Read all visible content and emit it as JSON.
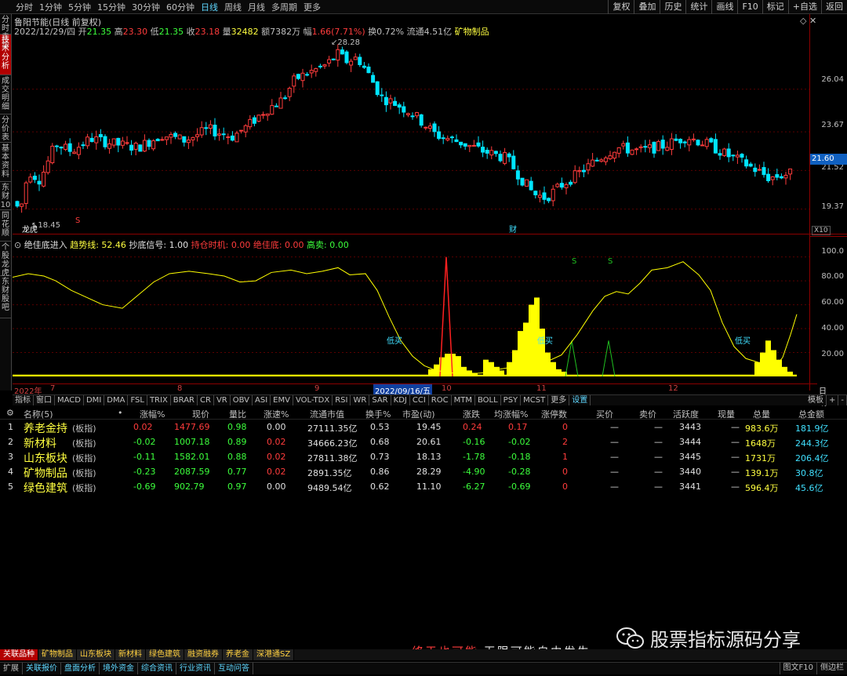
{
  "topbar": {
    "periods": [
      "分时",
      "1分钟",
      "5分钟",
      "15分钟",
      "30分钟",
      "60分钟",
      "日线",
      "周线",
      "月线",
      "多周期",
      "更多"
    ],
    "active_period": "日线",
    "right_buttons": [
      "复权",
      "叠加",
      "历史",
      "统计",
      "画线",
      "F10",
      "标记",
      "+自选",
      "返回"
    ]
  },
  "leftnav": [
    "分时走势",
    "技术分析",
    "成交明细",
    "分价表",
    "基本资料",
    "东财10",
    "同花顺",
    "个股龙虎",
    "东财股吧"
  ],
  "stock": {
    "title": "鲁阳节能(日线 前复权)",
    "date": "2022/12/29/四",
    "open_label": "开",
    "open": "21.35",
    "high_label": "高",
    "high": "23.30",
    "low_label": "低",
    "low": "21.35",
    "close_label": "收",
    "close": "23.18",
    "vol_label": "量",
    "vol": "32482",
    "amt_label": "额",
    "amt": "7382万",
    "amp_label": "幅",
    "amp": "1.66(7.71%)",
    "turn_label": "换",
    "turn": "0.72%",
    "float_label": "流通",
    "float": "4.51亿",
    "sector": "矿物制品"
  },
  "price_axis": {
    "ticks": [
      "26.04",
      "23.67",
      "21.52",
      "19.37"
    ],
    "current": "21.60",
    "bottom_label": "X10"
  },
  "annotations": {
    "high_mark": "28.28",
    "low_mark": "18.45",
    "mark1": "龙虎",
    "mark2": "财",
    "mark3": "S"
  },
  "indicator": {
    "name": "绝佳底进入",
    "trend_label": "趋势线: 52.46",
    "bottom_label": "抄底信号: 1.00",
    "hold_label": "持仓时机: 0.00",
    "best_label": "绝佳底: 0.00",
    "sell_label": "高卖: 0.00",
    "low_buy": "低买",
    "s_mark": "S",
    "axis": [
      "100.0",
      "80.00",
      "60.00",
      "40.00",
      "20.00"
    ]
  },
  "datebar": {
    "labels": [
      "2022年",
      "7",
      "8",
      "9",
      "2022/09/16/五",
      "10",
      "11",
      "12"
    ],
    "right": "日线"
  },
  "tabs": [
    "指标",
    "窗口",
    "MACD",
    "DMI",
    "DMA",
    "FSL",
    "TRIX",
    "BRAR",
    "CR",
    "VR",
    "OBV",
    "ASI",
    "EMV",
    "VOL-TDX",
    "RSI",
    "WR",
    "SAR",
    "KDJ",
    "CCI",
    "ROC",
    "MTM",
    "BOLL",
    "PSY",
    "MCST",
    "更多",
    "设置"
  ],
  "tabs_right": [
    "模板",
    "+",
    "-"
  ],
  "table": {
    "headers": [
      "名称(5)",
      "•",
      "涨幅%",
      "现价",
      "量比",
      "涨速%",
      "流通市值",
      "换手%",
      "市盈(动)",
      "涨跌",
      "均涨幅%",
      "涨停数",
      "买价",
      "卖价",
      "活跃度",
      "现量",
      "总量",
      "总金额"
    ],
    "rows": [
      {
        "idx": "1",
        "name": "养老金持",
        "tag": "(板指)",
        "chg": "0.02",
        "price": "1477.69",
        "vr": "0.98",
        "speed": "0.00",
        "mcap": "27111.35亿",
        "turn": "0.53",
        "pe": "19.45",
        "diff": "0.24",
        "avg": "0.17",
        "limit": "0",
        "buy": "—",
        "sell": "—",
        "act": "3443",
        "cur": "—",
        "vol": "983.6万",
        "amt": "181.9亿"
      },
      {
        "idx": "2",
        "name": "新材料",
        "tag": "(板指)",
        "chg": "-0.02",
        "price": "1007.18",
        "vr": "0.89",
        "speed": "0.02",
        "mcap": "34666.23亿",
        "turn": "0.68",
        "pe": "20.61",
        "diff": "-0.16",
        "avg": "-0.02",
        "limit": "2",
        "buy": "—",
        "sell": "—",
        "act": "3444",
        "cur": "—",
        "vol": "1648万",
        "amt": "244.3亿"
      },
      {
        "idx": "3",
        "name": "山东板块",
        "tag": "(板指)",
        "chg": "-0.11",
        "price": "1582.01",
        "vr": "0.88",
        "speed": "0.02",
        "mcap": "27811.38亿",
        "turn": "0.73",
        "pe": "18.13",
        "diff": "-1.78",
        "avg": "-0.18",
        "limit": "1",
        "buy": "—",
        "sell": "—",
        "act": "3445",
        "cur": "—",
        "vol": "1731万",
        "amt": "206.4亿"
      },
      {
        "idx": "4",
        "name": "矿物制品",
        "tag": "(板指)",
        "chg": "-0.23",
        "price": "2087.59",
        "vr": "0.77",
        "speed": "0.02",
        "mcap": "2891.35亿",
        "turn": "0.86",
        "pe": "28.29",
        "diff": "-4.90",
        "avg": "-0.28",
        "limit": "0",
        "buy": "—",
        "sell": "—",
        "act": "3440",
        "cur": "—",
        "vol": "139.1万",
        "amt": "30.8亿"
      },
      {
        "idx": "5",
        "name": "绿色建筑",
        "tag": "(板指)",
        "chg": "-0.69",
        "price": "902.79",
        "vr": "0.97",
        "speed": "0.00",
        "mcap": "9489.54亿",
        "turn": "0.62",
        "pe": "11.10",
        "diff": "-6.27",
        "avg": "-0.69",
        "limit": "0",
        "buy": "—",
        "sell": "—",
        "act": "3441",
        "cur": "—",
        "vol": "596.4万",
        "amt": "45.6亿"
      }
    ]
  },
  "bottom_tabs": [
    "关联品种",
    "矿物制品",
    "山东板块",
    "新材料",
    "绿色建筑",
    "融资融券",
    "养老金",
    "深港通SZ"
  ],
  "bottom_tabs2": [
    "扩展",
    "关联报价",
    "盘面分析",
    "境外资金",
    "综合资讯",
    "行业资讯",
    "互动问答"
  ],
  "bottom_right": [
    "图文F10",
    "侧边栏"
  ],
  "slogan_red": "终于也可能",
  "slogan_white": "无限可能自由发生",
  "watermark": "股票指标源码分享",
  "colors": {
    "up": "#ff3c3c",
    "down": "#00e5ff",
    "trend": "#ffff00",
    "grid": "#8b0000"
  }
}
